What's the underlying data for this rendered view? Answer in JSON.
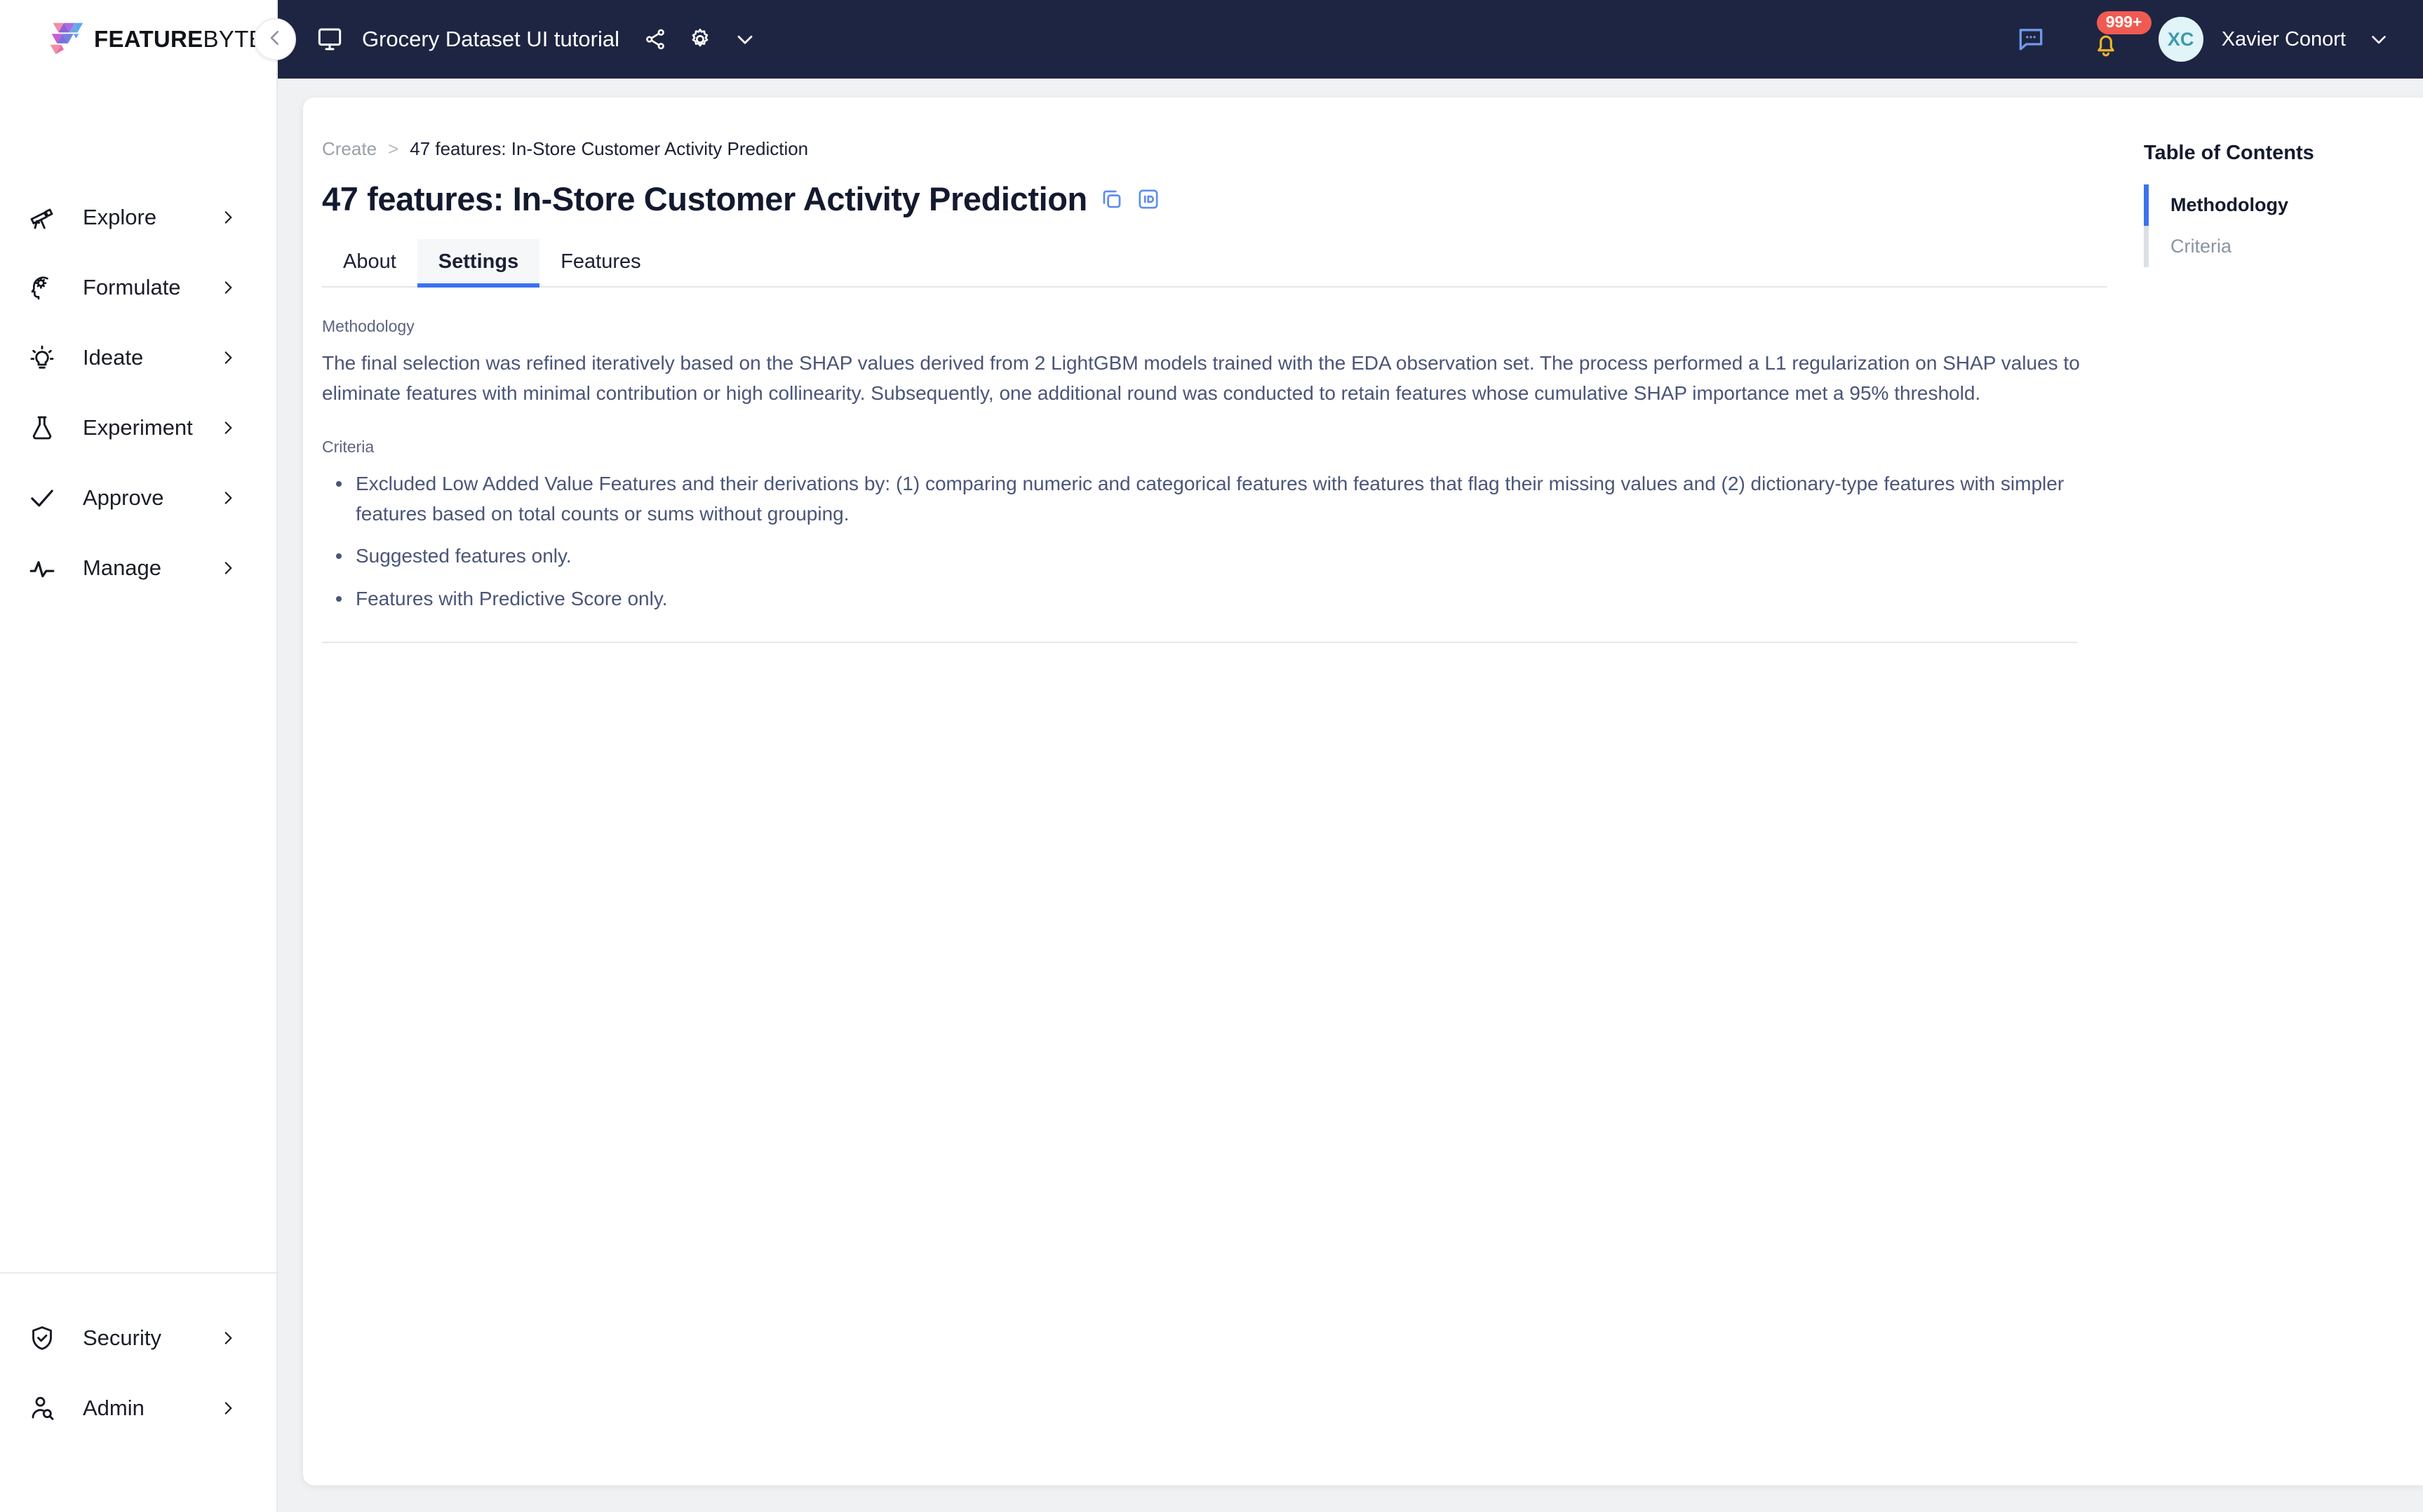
{
  "brand": {
    "logo_text_bold": "FEATURE",
    "logo_text_light": "BYTE",
    "logo_icon": "featurebyte-logo-icon",
    "accent": "#3b72f0",
    "topbar_bg": "#1e2542"
  },
  "topbar": {
    "workspace_icon": "monitor-icon",
    "workspace_title": "Grocery Dataset UI tutorial",
    "share_icon": "share-nodes-icon",
    "settings_icon": "gear-icon",
    "more_icon": "chevron-down-icon",
    "chat_icon": "chat-bubble-icon",
    "bell_icon": "bell-icon",
    "notification_count": "999+",
    "avatar_initials": "XC",
    "user_name": "Xavier Conort",
    "user_menu_icon": "chevron-down-icon"
  },
  "sidebar": {
    "collapse_icon": "chevron-left-icon",
    "main_items": [
      {
        "label": "Explore",
        "icon": "telescope-icon",
        "chevron": "chevron-right-icon"
      },
      {
        "label": "Formulate",
        "icon": "head-gear-icon",
        "chevron": "chevron-right-icon"
      },
      {
        "label": "Ideate",
        "icon": "lightbulb-icon",
        "chevron": "chevron-right-icon"
      },
      {
        "label": "Experiment",
        "icon": "flask-icon",
        "chevron": "chevron-right-icon"
      },
      {
        "label": "Approve",
        "icon": "check-icon",
        "chevron": "chevron-right-icon"
      },
      {
        "label": "Manage",
        "icon": "pulse-icon",
        "chevron": "chevron-right-icon"
      }
    ],
    "bottom_items": [
      {
        "label": "Security",
        "icon": "shield-check-icon",
        "chevron": "chevron-right-icon"
      },
      {
        "label": "Admin",
        "icon": "user-search-icon",
        "chevron": "chevron-right-icon"
      }
    ]
  },
  "breadcrumb": {
    "parent": "Create",
    "separator": ">",
    "current": "47 features: In-Store Customer Activity Prediction"
  },
  "page": {
    "title": "47 features: In-Store Customer Activity Prediction",
    "copy_icon": "copy-icon",
    "id_icon": "id-badge-icon"
  },
  "tabs": [
    {
      "label": "About",
      "active": false
    },
    {
      "label": "Settings",
      "active": true
    },
    {
      "label": "Features",
      "active": false
    }
  ],
  "sections": {
    "methodology": {
      "heading": "Methodology",
      "body": "The final selection was refined iteratively based on the SHAP values derived from 2 LightGBM models trained with the EDA observation set. The process performed a L1 regularization on SHAP values to eliminate features with minimal contribution or high collinearity. Subsequently, one additional round was conducted to retain features whose cumulative SHAP importance met a 95% threshold."
    },
    "criteria": {
      "heading": "Criteria",
      "items": [
        "Excluded Low Added Value Features and their derivations by: (1) comparing numeric and categorical features with features that flag their missing values and (2) dictionary-type features with simpler features based on total counts or sums without grouping.",
        "Suggested features only.",
        "Features with Predictive Score only."
      ]
    }
  },
  "toc": {
    "title": "Table of Contents",
    "items": [
      {
        "label": "Methodology",
        "active": true
      },
      {
        "label": "Criteria",
        "active": false
      }
    ]
  }
}
